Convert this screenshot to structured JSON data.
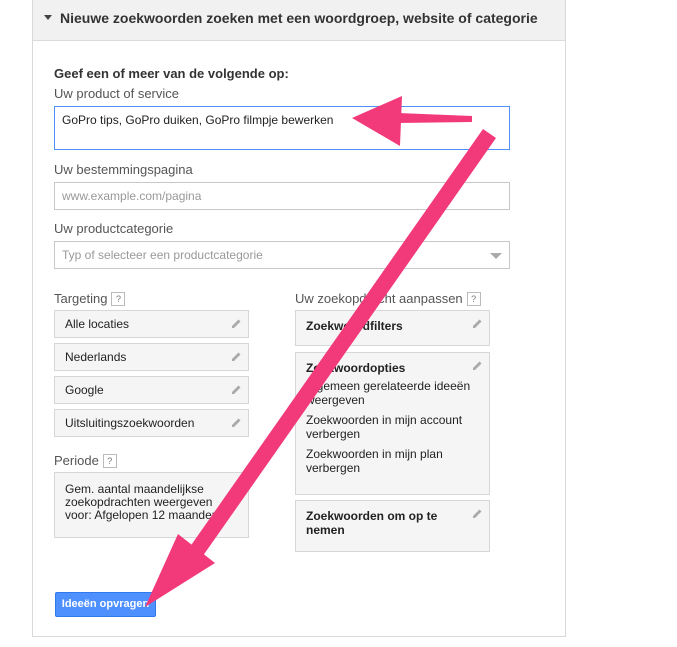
{
  "header": {
    "title": "Nieuwe zoekwoorden zoeken met een woordgroep, website of categorie"
  },
  "form": {
    "intro": "Geef een of meer van de volgende op:",
    "product_label": "Uw product of service",
    "product_value": "GoPro tips, GoPro duiken, GoPro filmpje bewerken",
    "landing_label": "Uw bestemmingspagina",
    "landing_placeholder": "www.example.com/pagina",
    "category_label": "Uw productcategorie",
    "category_placeholder": "Typ of selecteer een productcategorie"
  },
  "targeting": {
    "label": "Targeting",
    "help": "?",
    "items": [
      "Alle locaties",
      "Nederlands",
      "Google",
      "Uitsluitingszoekwoorden"
    ]
  },
  "periode": {
    "label": "Periode",
    "help": "?",
    "line1": "Gem. aantal maandelijkse",
    "line2": "zoekopdrachten weergeven",
    "line3": "voor: Afgelopen 12 maanden"
  },
  "customize": {
    "label": "Uw zoekopdracht aanpassen",
    "help": "?",
    "filters": "Zoekwoordfilters",
    "options_head": "Zoekwoordopties",
    "options": [
      "Algemeen gerelateerde ideeën weergeven",
      "Zoekwoorden in mijn account verbergen",
      "Zoekwoorden in mijn plan verbergen"
    ],
    "include": "Zoekwoorden om op te nemen"
  },
  "actions": {
    "submit": "Ideeën opvragen"
  },
  "colors": {
    "accent": "#4d90fe",
    "arrow": "#f23a7a"
  }
}
